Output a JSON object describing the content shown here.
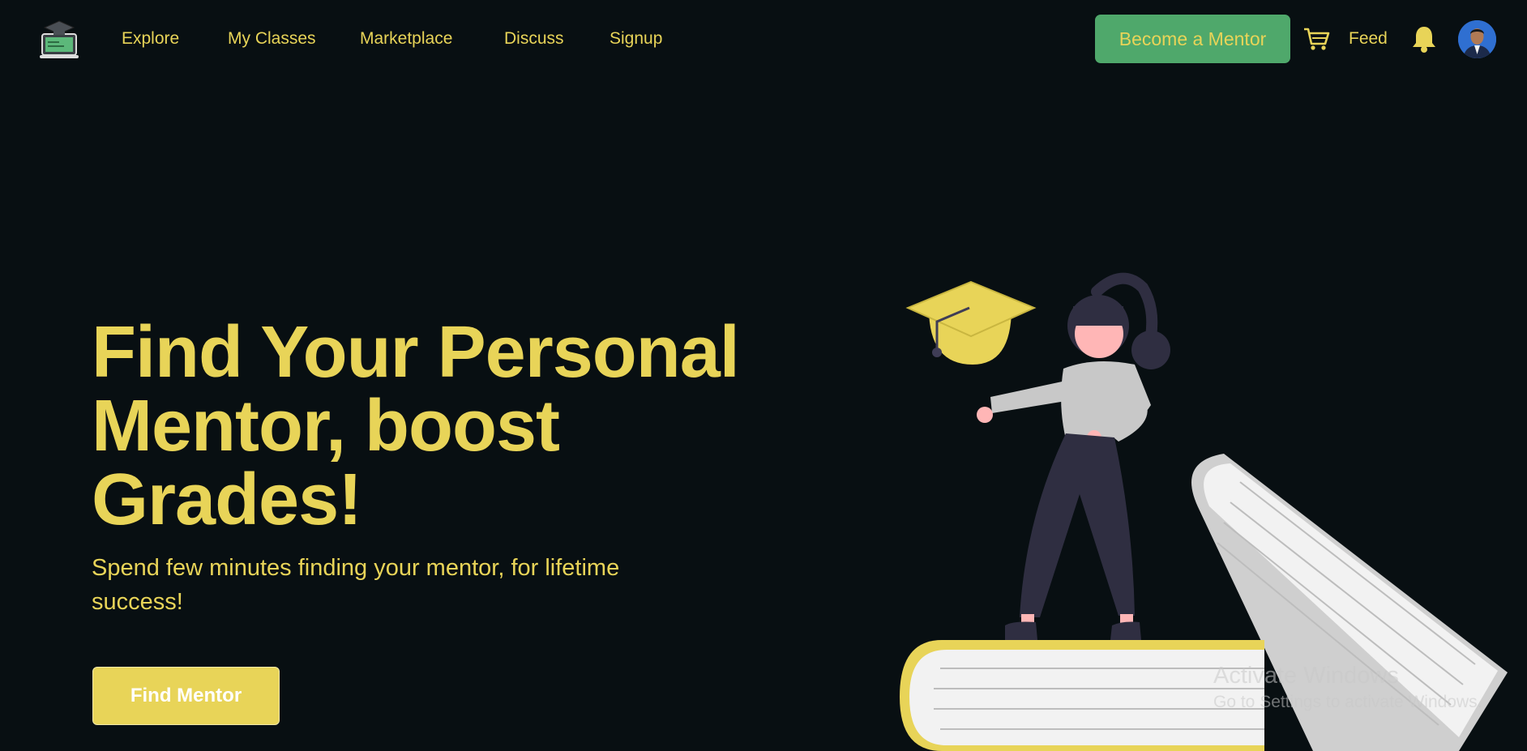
{
  "nav": {
    "links": [
      {
        "label": "Explore"
      },
      {
        "label": "My Classes"
      },
      {
        "label": "Marketplace"
      },
      {
        "label": "Discuss"
      },
      {
        "label": "Signup"
      }
    ],
    "become_mentor_label": "Become a Mentor",
    "feed_label": "Feed",
    "icons": {
      "logo": "graduation-laptop-logo",
      "cart": "cart-icon",
      "bell": "bell-icon",
      "avatar": "user-avatar"
    }
  },
  "hero": {
    "title": "Find Your Personal Mentor, boost Grades!",
    "subtitle": "Spend few minutes finding your mentor, for lifetime success!",
    "cta_label": "Find Mentor"
  },
  "watermark": {
    "title": "Activate Windows",
    "subtitle": "Go to Settings to activate Windows."
  },
  "colors": {
    "background": "#080f12",
    "accent_yellow": "#e8d458",
    "mentor_green": "#4fa86b"
  }
}
